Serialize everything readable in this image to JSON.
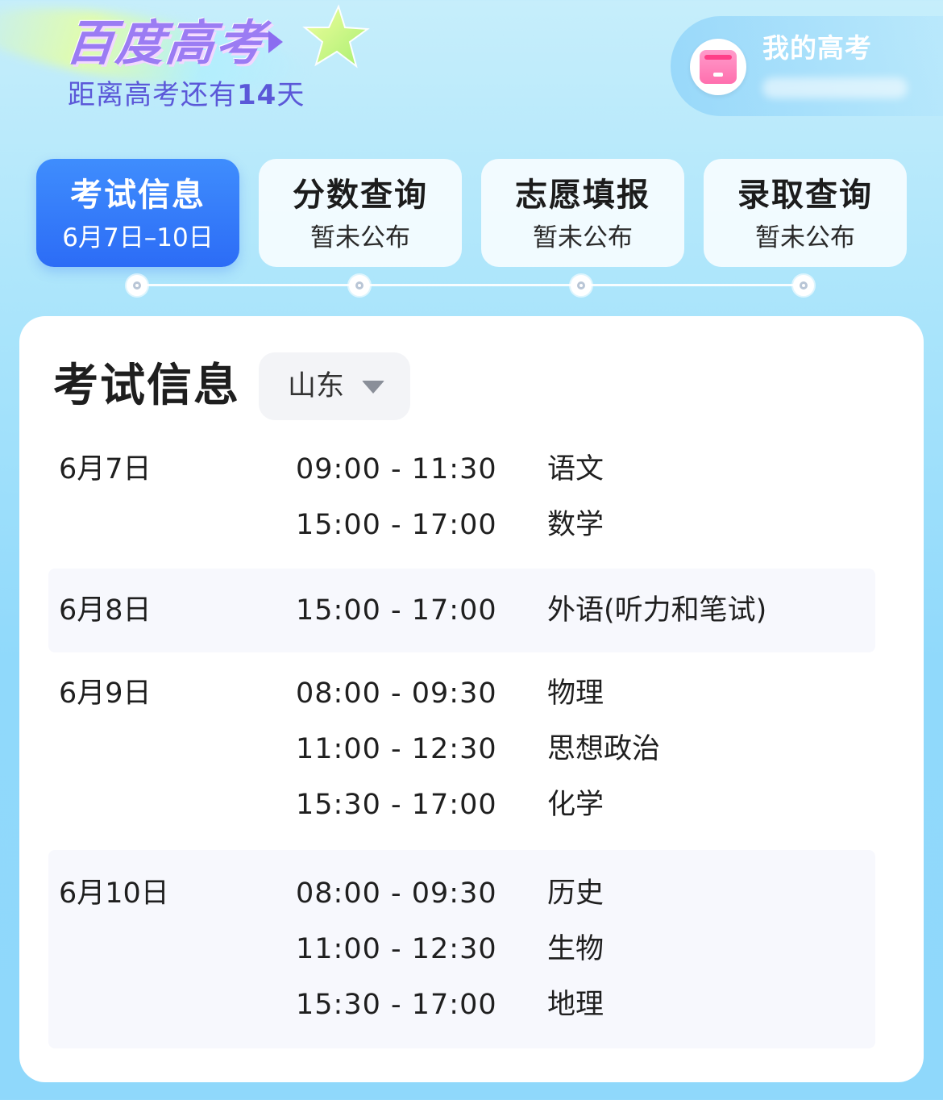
{
  "header": {
    "logo_text": "百度高考",
    "countdown": {
      "prefix": "距离高考还有",
      "days": "14",
      "suffix": "天"
    },
    "my_gaokao": {
      "label": "我的高考"
    }
  },
  "tabs": [
    {
      "title": "考试信息",
      "sub": "6月7日–10日",
      "active": true
    },
    {
      "title": "分数查询",
      "sub": "暂未公布",
      "active": false
    },
    {
      "title": "志愿填报",
      "sub": "暂未公布",
      "active": false
    },
    {
      "title": "录取查询",
      "sub": "暂未公布",
      "active": false
    }
  ],
  "card": {
    "title": "考试信息",
    "province": "山东",
    "schedule": [
      {
        "date": "6月7日",
        "slots": [
          {
            "time": "09:00 - 11:30",
            "subject": "语文"
          },
          {
            "time": "15:00 - 17:00",
            "subject": "数学"
          }
        ]
      },
      {
        "date": "6月8日",
        "slots": [
          {
            "time": "15:00 - 17:00",
            "subject": "外语(听力和笔试)"
          }
        ]
      },
      {
        "date": "6月9日",
        "slots": [
          {
            "time": "08:00 - 09:30",
            "subject": "物理"
          },
          {
            "time": "11:00 - 12:30",
            "subject": "思想政治"
          },
          {
            "time": "15:30 - 17:00",
            "subject": "化学"
          }
        ]
      },
      {
        "date": "6月10日",
        "slots": [
          {
            "time": "08:00 - 09:30",
            "subject": "历史"
          },
          {
            "time": "11:00 - 12:30",
            "subject": "生物"
          },
          {
            "time": "15:30 - 17:00",
            "subject": "地理"
          }
        ]
      }
    ]
  },
  "colors": {
    "accent": "#2c6cf6",
    "brand_purple": "#9b7cf3",
    "countdown": "#5b58d8",
    "shaded_row": "#f7f8fd"
  }
}
